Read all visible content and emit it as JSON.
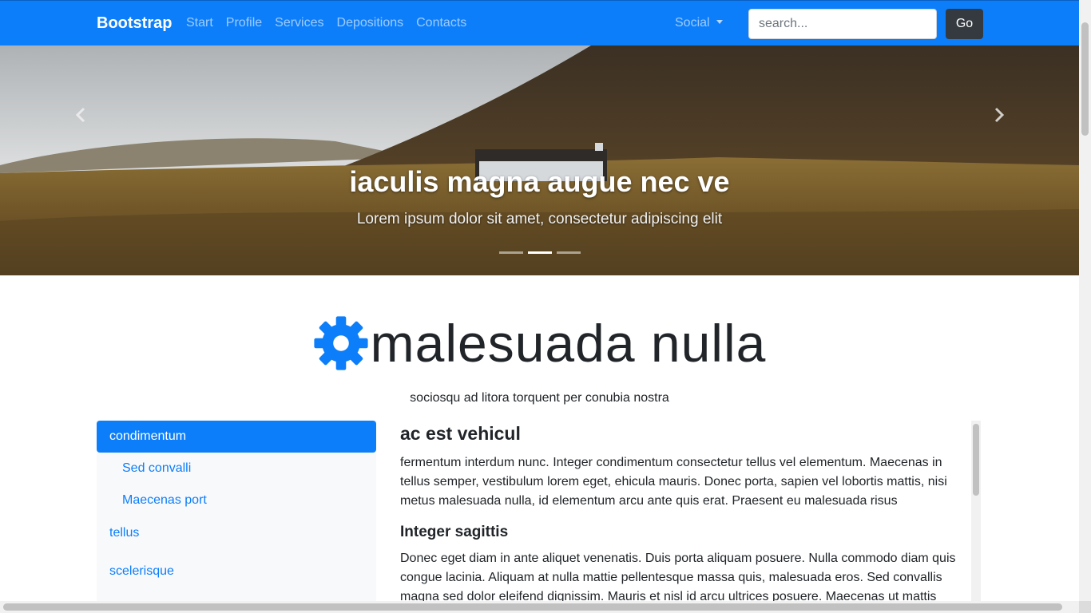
{
  "navbar": {
    "brand": "Bootstrap",
    "links": [
      "Start",
      "Profile",
      "Services",
      "Depositions",
      "Contacts"
    ],
    "social_label": "Social",
    "search_placeholder": "search...",
    "go_label": "Go",
    "color": "#0d7ef9"
  },
  "carousel": {
    "title": "iaculis magna augue nec ve",
    "subtitle": "Lorem ipsum dolor sit amet, consectetur adipiscing elit",
    "indicator_count": 3,
    "active_index": 1
  },
  "heading": {
    "icon": "gear-icon",
    "title": "malesuada nulla",
    "subtitle": "sociosqu ad litora torquent per conubia nostra"
  },
  "sidebar": {
    "active": "condimentum",
    "sub_items": [
      "Sed convalli",
      "Maecenas port"
    ],
    "items": [
      "tellus",
      "scelerisque"
    ]
  },
  "content": {
    "section1_title": "ac est vehicul",
    "section1_text": "fermentum interdum nunc. Integer condimentum consectetur tellus vel elementum. Maecenas in tellus semper, vestibulum lorem eget, ehicula mauris. Donec porta, sapien vel lobortis mattis, nisi metus malesuada nulla, id elementum arcu ante quis erat. Praesent eu malesuada risus",
    "section2_title": "Integer sagittis",
    "section2_text": "Donec eget diam in ante aliquet venenatis. Duis porta aliquam posuere. Nulla commodo diam quis congue lacinia. Aliquam at nulla mattie pellentesque massa quis, malesuada eros. Sed convallis magna sed dolor eleifend dignissim. Mauris et nisl id arcu ultrices posuere. Maecenas ut mattis"
  }
}
